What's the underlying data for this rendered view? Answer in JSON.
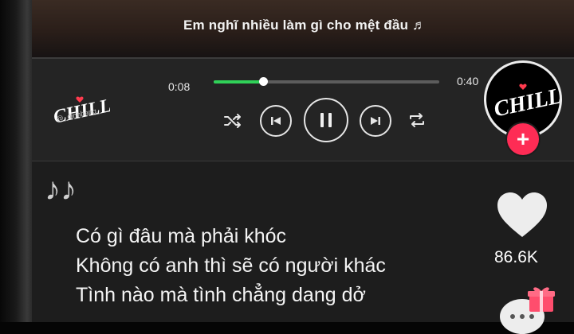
{
  "video": {
    "subtitle": "Em nghĩ nhiều làm gì cho mệt đầu ♬"
  },
  "player": {
    "logo_text": "CHILL",
    "handle": "@_dinhbang_",
    "current_time": "0:08",
    "total_time": "0:40",
    "progress": 0.22,
    "accent_color": "#30d158"
  },
  "controls": {
    "shuffle": "shuffle-icon",
    "previous": "previous-icon",
    "play_pause": "pause-icon",
    "next": "next-icon",
    "repeat": "repeat-icon"
  },
  "creator": {
    "avatar_text": "CHILL",
    "follow_symbol": "+",
    "follow_color": "#fe2c55"
  },
  "lyrics": {
    "notes": "♪♪",
    "lines": [
      "Có gì đâu mà phải khóc",
      "Không có anh thì sẽ có người khác",
      "Tình nào mà tình chẳng dang dở"
    ]
  },
  "actions": {
    "like_count": "86.6K"
  }
}
